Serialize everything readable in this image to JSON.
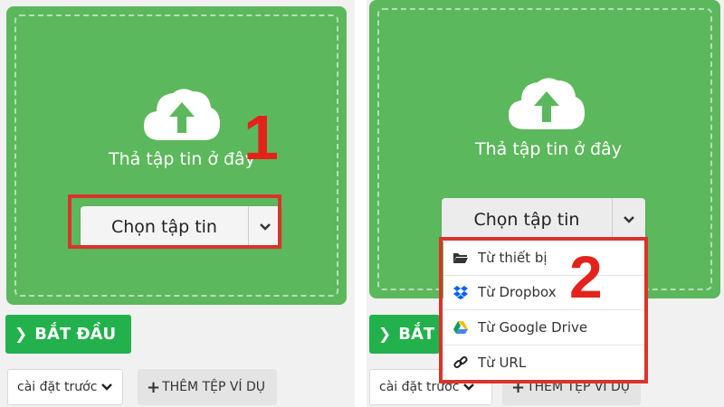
{
  "left": {
    "drop_text": "Thả tập tin ở đây",
    "choose_label": "Chọn tập tin",
    "step_number": "1",
    "start_label": "BẮT ĐẦU",
    "preset_label": "cài đặt trước",
    "example_label": "THÊM TỆP VÍ DỤ"
  },
  "right": {
    "drop_text": "Thả tập tin ở đây",
    "choose_label": "Chọn tập tin",
    "step_number": "2",
    "start_label": "BẮT ĐẦU",
    "preset_label": "cài đặt trước",
    "example_label": "THÊM TỆP VÍ DỤ",
    "menu": [
      {
        "label": "Từ thiết bị",
        "icon": "folder-icon"
      },
      {
        "label": "Từ Dropbox",
        "icon": "dropbox-icon"
      },
      {
        "label": "Từ Google Drive",
        "icon": "google-drive-icon"
      },
      {
        "label": "Từ URL",
        "icon": "link-icon"
      }
    ]
  },
  "colors": {
    "dropzone_green": "#5cb85c",
    "start_green": "#22b14c",
    "highlight_red": "#d9342b"
  }
}
